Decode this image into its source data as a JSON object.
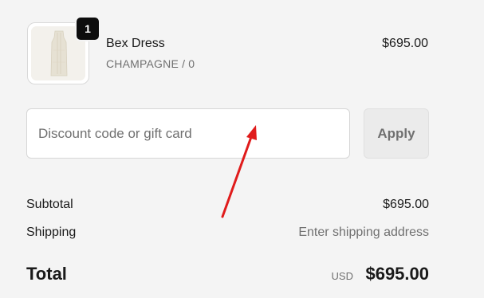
{
  "product": {
    "name": "Bex Dress",
    "variant": "CHAMPAGNE / 0",
    "price": "$695.00",
    "quantity": "1"
  },
  "discount": {
    "placeholder": "Discount code or gift card",
    "value": "",
    "apply_label": "Apply"
  },
  "summary": {
    "subtotal_label": "Subtotal",
    "subtotal_value": "$695.00",
    "shipping_label": "Shipping",
    "shipping_value": "Enter shipping address",
    "total_label": "Total",
    "total_currency": "USD",
    "total_value": "$695.00"
  },
  "colors": {
    "background": "#f4f4f4",
    "annotation_arrow": "#e01b1b",
    "badge": "#0d0d0d",
    "muted_text": "#707070"
  },
  "icons": {
    "annotation": "red-arrow-pointer"
  }
}
